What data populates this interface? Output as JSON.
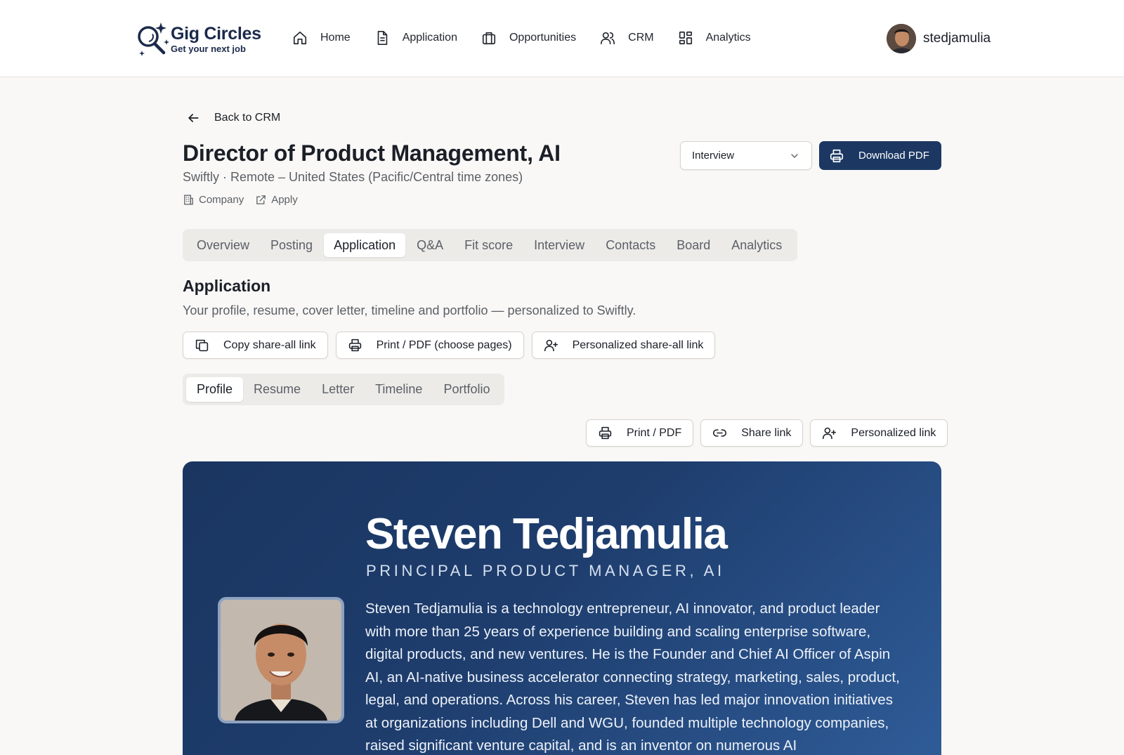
{
  "app": {
    "name": "Gig Circles",
    "tagline": "Get your next job"
  },
  "nav": {
    "items": [
      {
        "label": "Home",
        "icon": "home-icon"
      },
      {
        "label": "Application",
        "icon": "document-icon"
      },
      {
        "label": "Opportunities",
        "icon": "briefcase-icon"
      },
      {
        "label": "CRM",
        "icon": "users-icon"
      },
      {
        "label": "Analytics",
        "icon": "grid-icon"
      }
    ]
  },
  "user": {
    "username": "stedjamulia"
  },
  "header": {
    "back_label": "Back to CRM",
    "title": "Director of Product Management, AI",
    "subtitle": "Swiftly · Remote – United States (Pacific/Central time zones)",
    "company_link": "Company",
    "apply_link": "Apply",
    "status_value": "Interview",
    "download_label": "Download PDF"
  },
  "tabs": {
    "items": [
      "Overview",
      "Posting",
      "Application",
      "Q&A",
      "Fit score",
      "Interview",
      "Contacts",
      "Board",
      "Analytics"
    ],
    "active": "Application"
  },
  "application": {
    "title": "Application",
    "description": "Your profile, resume, cover letter, timeline and portfolio — personalized to Swiftly.",
    "actions": {
      "copy_all": "Copy share-all link",
      "print_pages": "Print / PDF (choose pages)",
      "personalized_all": "Personalized share-all link"
    }
  },
  "subtabs": {
    "items": [
      "Profile",
      "Resume",
      "Letter",
      "Timeline",
      "Portfolio"
    ],
    "active": "Profile"
  },
  "profile_actions": {
    "print": "Print / PDF",
    "share": "Share link",
    "personalized": "Personalized link"
  },
  "profile": {
    "name": "Steven Tedjamulia",
    "role": "PRINCIPAL PRODUCT MANAGER, AI",
    "bio": "Steven Tedjamulia is a technology entrepreneur, AI innovator, and product leader with more than 25 years of experience building and scaling enterprise software, digital products, and new ventures. He is the Founder and Chief AI Officer of Aspin AI, an AI-native business accelerator connecting strategy, marketing, sales, product, legal, and operations. Across his career, Steven has led major innovation initiatives at organizations including Dell and WGU, founded multiple technology companies, raised significant venture capital, and is an inventor on numerous AI"
  }
}
